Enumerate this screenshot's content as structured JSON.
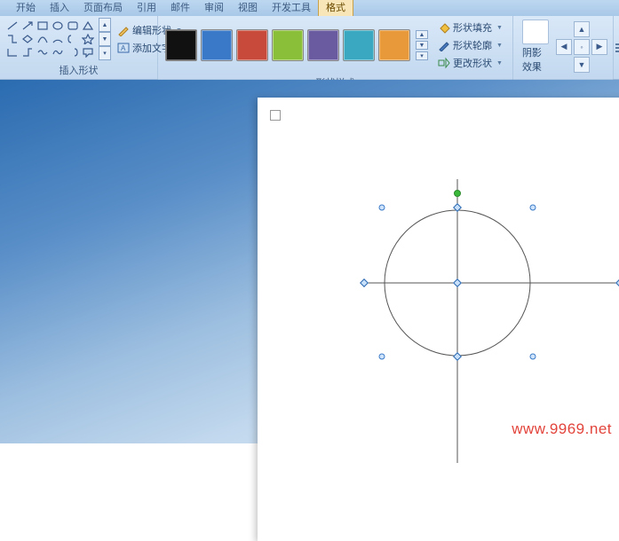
{
  "tabs": [
    "开始",
    "插入",
    "页面布局",
    "引用",
    "邮件",
    "审阅",
    "视图",
    "开发工具",
    "格式"
  ],
  "activeTab": 8,
  "groups": {
    "insertShape": "插入形状",
    "shapeStyles": "形状样式",
    "shadowEffects": "阴影效果"
  },
  "insertShapeBtns": {
    "edit": "编辑形状",
    "addText": "添加文字"
  },
  "shapeStyleBtns": {
    "fill": "形状填充",
    "outline": "形状轮廓",
    "change": "更改形状"
  },
  "shadowBtn": "阴影效果",
  "colors": [
    "#111111",
    "#3a78c8",
    "#c84a3a",
    "#8abf3a",
    "#6a5aa0",
    "#3aa8c0",
    "#e89a3a"
  ],
  "watermark": "www.9969.net"
}
